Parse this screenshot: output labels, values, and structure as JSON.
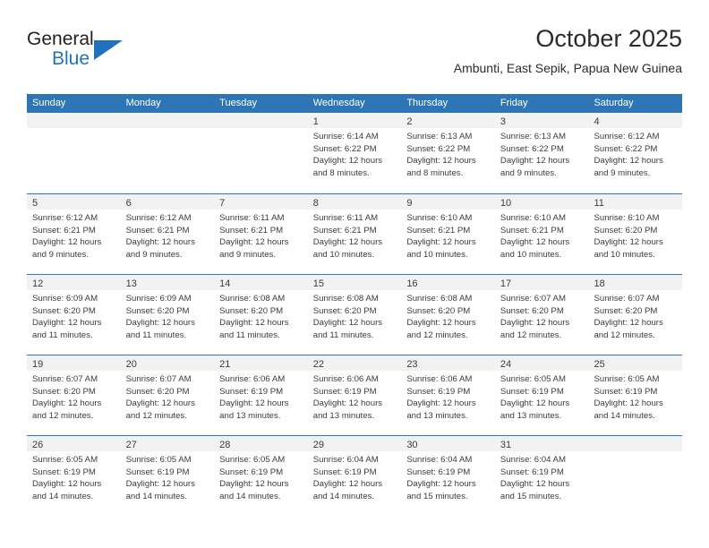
{
  "brand": {
    "name_part1": "General",
    "name_part2": "Blue",
    "flag_icon": "triangle-flag-icon",
    "accent_color": "#1f72bd"
  },
  "header": {
    "title": "October 2025",
    "subtitle": "Ambunti, East Sepik, Papua New Guinea"
  },
  "theme": {
    "header_blue": "#2e75b6",
    "day_band_gray": "#f2f2f2",
    "text_color": "#3c3c3c"
  },
  "calendar": {
    "weekdays": [
      "Sunday",
      "Monday",
      "Tuesday",
      "Wednesday",
      "Thursday",
      "Friday",
      "Saturday"
    ],
    "weeks": [
      [
        {
          "day": "",
          "empty": true,
          "sunrise": "",
          "sunset": "",
          "daylight_line1": "",
          "daylight_line2": ""
        },
        {
          "day": "",
          "empty": true,
          "sunrise": "",
          "sunset": "",
          "daylight_line1": "",
          "daylight_line2": ""
        },
        {
          "day": "",
          "empty": true,
          "sunrise": "",
          "sunset": "",
          "daylight_line1": "",
          "daylight_line2": ""
        },
        {
          "day": "1",
          "empty": false,
          "sunrise": "Sunrise: 6:14 AM",
          "sunset": "Sunset: 6:22 PM",
          "daylight_line1": "Daylight: 12 hours",
          "daylight_line2": "and 8 minutes."
        },
        {
          "day": "2",
          "empty": false,
          "sunrise": "Sunrise: 6:13 AM",
          "sunset": "Sunset: 6:22 PM",
          "daylight_line1": "Daylight: 12 hours",
          "daylight_line2": "and 8 minutes."
        },
        {
          "day": "3",
          "empty": false,
          "sunrise": "Sunrise: 6:13 AM",
          "sunset": "Sunset: 6:22 PM",
          "daylight_line1": "Daylight: 12 hours",
          "daylight_line2": "and 9 minutes."
        },
        {
          "day": "4",
          "empty": false,
          "sunrise": "Sunrise: 6:12 AM",
          "sunset": "Sunset: 6:22 PM",
          "daylight_line1": "Daylight: 12 hours",
          "daylight_line2": "and 9 minutes."
        }
      ],
      [
        {
          "day": "5",
          "empty": false,
          "sunrise": "Sunrise: 6:12 AM",
          "sunset": "Sunset: 6:21 PM",
          "daylight_line1": "Daylight: 12 hours",
          "daylight_line2": "and 9 minutes."
        },
        {
          "day": "6",
          "empty": false,
          "sunrise": "Sunrise: 6:12 AM",
          "sunset": "Sunset: 6:21 PM",
          "daylight_line1": "Daylight: 12 hours",
          "daylight_line2": "and 9 minutes."
        },
        {
          "day": "7",
          "empty": false,
          "sunrise": "Sunrise: 6:11 AM",
          "sunset": "Sunset: 6:21 PM",
          "daylight_line1": "Daylight: 12 hours",
          "daylight_line2": "and 9 minutes."
        },
        {
          "day": "8",
          "empty": false,
          "sunrise": "Sunrise: 6:11 AM",
          "sunset": "Sunset: 6:21 PM",
          "daylight_line1": "Daylight: 12 hours",
          "daylight_line2": "and 10 minutes."
        },
        {
          "day": "9",
          "empty": false,
          "sunrise": "Sunrise: 6:10 AM",
          "sunset": "Sunset: 6:21 PM",
          "daylight_line1": "Daylight: 12 hours",
          "daylight_line2": "and 10 minutes."
        },
        {
          "day": "10",
          "empty": false,
          "sunrise": "Sunrise: 6:10 AM",
          "sunset": "Sunset: 6:21 PM",
          "daylight_line1": "Daylight: 12 hours",
          "daylight_line2": "and 10 minutes."
        },
        {
          "day": "11",
          "empty": false,
          "sunrise": "Sunrise: 6:10 AM",
          "sunset": "Sunset: 6:20 PM",
          "daylight_line1": "Daylight: 12 hours",
          "daylight_line2": "and 10 minutes."
        }
      ],
      [
        {
          "day": "12",
          "empty": false,
          "sunrise": "Sunrise: 6:09 AM",
          "sunset": "Sunset: 6:20 PM",
          "daylight_line1": "Daylight: 12 hours",
          "daylight_line2": "and 11 minutes."
        },
        {
          "day": "13",
          "empty": false,
          "sunrise": "Sunrise: 6:09 AM",
          "sunset": "Sunset: 6:20 PM",
          "daylight_line1": "Daylight: 12 hours",
          "daylight_line2": "and 11 minutes."
        },
        {
          "day": "14",
          "empty": false,
          "sunrise": "Sunrise: 6:08 AM",
          "sunset": "Sunset: 6:20 PM",
          "daylight_line1": "Daylight: 12 hours",
          "daylight_line2": "and 11 minutes."
        },
        {
          "day": "15",
          "empty": false,
          "sunrise": "Sunrise: 6:08 AM",
          "sunset": "Sunset: 6:20 PM",
          "daylight_line1": "Daylight: 12 hours",
          "daylight_line2": "and 11 minutes."
        },
        {
          "day": "16",
          "empty": false,
          "sunrise": "Sunrise: 6:08 AM",
          "sunset": "Sunset: 6:20 PM",
          "daylight_line1": "Daylight: 12 hours",
          "daylight_line2": "and 12 minutes."
        },
        {
          "day": "17",
          "empty": false,
          "sunrise": "Sunrise: 6:07 AM",
          "sunset": "Sunset: 6:20 PM",
          "daylight_line1": "Daylight: 12 hours",
          "daylight_line2": "and 12 minutes."
        },
        {
          "day": "18",
          "empty": false,
          "sunrise": "Sunrise: 6:07 AM",
          "sunset": "Sunset: 6:20 PM",
          "daylight_line1": "Daylight: 12 hours",
          "daylight_line2": "and 12 minutes."
        }
      ],
      [
        {
          "day": "19",
          "empty": false,
          "sunrise": "Sunrise: 6:07 AM",
          "sunset": "Sunset: 6:20 PM",
          "daylight_line1": "Daylight: 12 hours",
          "daylight_line2": "and 12 minutes."
        },
        {
          "day": "20",
          "empty": false,
          "sunrise": "Sunrise: 6:07 AM",
          "sunset": "Sunset: 6:20 PM",
          "daylight_line1": "Daylight: 12 hours",
          "daylight_line2": "and 12 minutes."
        },
        {
          "day": "21",
          "empty": false,
          "sunrise": "Sunrise: 6:06 AM",
          "sunset": "Sunset: 6:19 PM",
          "daylight_line1": "Daylight: 12 hours",
          "daylight_line2": "and 13 minutes."
        },
        {
          "day": "22",
          "empty": false,
          "sunrise": "Sunrise: 6:06 AM",
          "sunset": "Sunset: 6:19 PM",
          "daylight_line1": "Daylight: 12 hours",
          "daylight_line2": "and 13 minutes."
        },
        {
          "day": "23",
          "empty": false,
          "sunrise": "Sunrise: 6:06 AM",
          "sunset": "Sunset: 6:19 PM",
          "daylight_line1": "Daylight: 12 hours",
          "daylight_line2": "and 13 minutes."
        },
        {
          "day": "24",
          "empty": false,
          "sunrise": "Sunrise: 6:05 AM",
          "sunset": "Sunset: 6:19 PM",
          "daylight_line1": "Daylight: 12 hours",
          "daylight_line2": "and 13 minutes."
        },
        {
          "day": "25",
          "empty": false,
          "sunrise": "Sunrise: 6:05 AM",
          "sunset": "Sunset: 6:19 PM",
          "daylight_line1": "Daylight: 12 hours",
          "daylight_line2": "and 14 minutes."
        }
      ],
      [
        {
          "day": "26",
          "empty": false,
          "sunrise": "Sunrise: 6:05 AM",
          "sunset": "Sunset: 6:19 PM",
          "daylight_line1": "Daylight: 12 hours",
          "daylight_line2": "and 14 minutes."
        },
        {
          "day": "27",
          "empty": false,
          "sunrise": "Sunrise: 6:05 AM",
          "sunset": "Sunset: 6:19 PM",
          "daylight_line1": "Daylight: 12 hours",
          "daylight_line2": "and 14 minutes."
        },
        {
          "day": "28",
          "empty": false,
          "sunrise": "Sunrise: 6:05 AM",
          "sunset": "Sunset: 6:19 PM",
          "daylight_line1": "Daylight: 12 hours",
          "daylight_line2": "and 14 minutes."
        },
        {
          "day": "29",
          "empty": false,
          "sunrise": "Sunrise: 6:04 AM",
          "sunset": "Sunset: 6:19 PM",
          "daylight_line1": "Daylight: 12 hours",
          "daylight_line2": "and 14 minutes."
        },
        {
          "day": "30",
          "empty": false,
          "sunrise": "Sunrise: 6:04 AM",
          "sunset": "Sunset: 6:19 PM",
          "daylight_line1": "Daylight: 12 hours",
          "daylight_line2": "and 15 minutes."
        },
        {
          "day": "31",
          "empty": false,
          "sunrise": "Sunrise: 6:04 AM",
          "sunset": "Sunset: 6:19 PM",
          "daylight_line1": "Daylight: 12 hours",
          "daylight_line2": "and 15 minutes."
        },
        {
          "day": "",
          "empty": true,
          "sunrise": "",
          "sunset": "",
          "daylight_line1": "",
          "daylight_line2": ""
        }
      ]
    ]
  }
}
